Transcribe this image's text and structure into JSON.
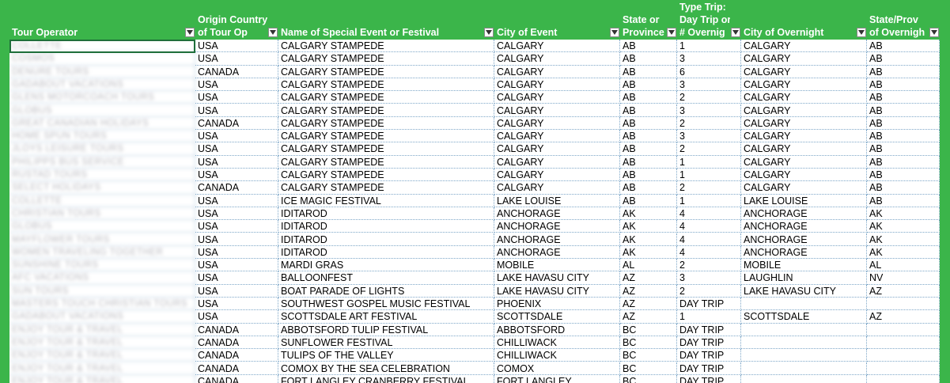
{
  "headers": [
    {
      "name": "tour-operator",
      "lines": [
        "Tour Operator"
      ]
    },
    {
      "name": "origin-country",
      "lines": [
        "Origin Country",
        "of Tour Op"
      ]
    },
    {
      "name": "event-name",
      "lines": [
        "Name of Special Event or Festival"
      ]
    },
    {
      "name": "city-of-event",
      "lines": [
        "City of Event"
      ]
    },
    {
      "name": "state-or-province",
      "lines": [
        "State or",
        "Province"
      ]
    },
    {
      "name": "type-trip",
      "lines": [
        "Type Trip:",
        "Day Trip or",
        "# Overnig"
      ]
    },
    {
      "name": "city-of-overnight",
      "lines": [
        "City of Overnight"
      ]
    },
    {
      "name": "state-prov-overnight",
      "lines": [
        "State/Prov",
        "of Overnigh"
      ]
    }
  ],
  "rows": [
    [
      "COLLETTE",
      "USA",
      "CALGARY STAMPEDE",
      "CALGARY",
      "AB",
      "1",
      "CALGARY",
      "AB"
    ],
    [
      "COSMOS",
      "USA",
      "CALGARY STAMPEDE",
      "CALGARY",
      "AB",
      "3",
      "CALGARY",
      "AB"
    ],
    [
      "DENURE TOURS",
      "CANADA",
      "CALGARY STAMPEDE",
      "CALGARY",
      "AB",
      "6",
      "CALGARY",
      "AB"
    ],
    [
      "GADABOUT VACATIONS",
      "USA",
      "CALGARY STAMPEDE",
      "CALGARY",
      "AB",
      "3",
      "CALGARY",
      "AB"
    ],
    [
      "GLENS MOTORCOACH TOURS",
      "USA",
      "CALGARY STAMPEDE",
      "CALGARY",
      "AB",
      "2",
      "CALGARY",
      "AB"
    ],
    [
      "GLOBUS",
      "USA",
      "CALGARY STAMPEDE",
      "CALGARY",
      "AB",
      "3",
      "CALGARY",
      "AB"
    ],
    [
      "GREAT CANADIAN HOLIDAYS",
      "CANADA",
      "CALGARY STAMPEDE",
      "CALGARY",
      "AB",
      "2",
      "CALGARY",
      "AB"
    ],
    [
      "HOME SPUN TOURS",
      "USA",
      "CALGARY STAMPEDE",
      "CALGARY",
      "AB",
      "3",
      "CALGARY",
      "AB"
    ],
    [
      "JLOYS LEISURE TOURS",
      "USA",
      "CALGARY STAMPEDE",
      "CALGARY",
      "AB",
      "2",
      "CALGARY",
      "AB"
    ],
    [
      "PHILIPPS BUS SERVICE",
      "USA",
      "CALGARY STAMPEDE",
      "CALGARY",
      "AB",
      "1",
      "CALGARY",
      "AB"
    ],
    [
      "RUSTAD TOURS",
      "USA",
      "CALGARY STAMPEDE",
      "CALGARY",
      "AB",
      "1",
      "CALGARY",
      "AB"
    ],
    [
      "SELECT HOLIDAYS",
      "CANADA",
      "CALGARY STAMPEDE",
      "CALGARY",
      "AB",
      "2",
      "CALGARY",
      "AB"
    ],
    [
      "COLLETTE",
      "USA",
      "ICE MAGIC FESTIVAL",
      "LAKE LOUISE",
      "AB",
      "1",
      "LAKE LOUISE",
      "AB"
    ],
    [
      "CHRISTIAN TOURS",
      "USA",
      "IDITAROD",
      "ANCHORAGE",
      "AK",
      "4",
      "ANCHORAGE",
      "AK"
    ],
    [
      "GLOBUS",
      "USA",
      "IDITAROD",
      "ANCHORAGE",
      "AK",
      "4",
      "ANCHORAGE",
      "AK"
    ],
    [
      "MAYFLOWER TOURS",
      "USA",
      "IDITAROD",
      "ANCHORAGE",
      "AK",
      "4",
      "ANCHORAGE",
      "AK"
    ],
    [
      "WOMEN TRAVELING TOGETHER",
      "USA",
      "IDITAROD",
      "ANCHORAGE",
      "AK",
      "4",
      "ANCHORAGE",
      "AK"
    ],
    [
      "SUNSHINE TOURS",
      "USA",
      "MARDI GRAS",
      "MOBILE",
      "AL",
      "2",
      "MOBILE",
      "AL"
    ],
    [
      "AFC VACATIONS",
      "USA",
      "BALLOONFEST",
      "LAKE HAVASU CITY",
      "AZ",
      "3",
      "LAUGHLIN",
      "NV"
    ],
    [
      "SUN TOURS",
      "USA",
      "BOAT PARADE OF LIGHTS",
      "LAKE HAVASU CITY",
      "AZ",
      "2",
      "LAKE HAVASU CITY",
      "AZ"
    ],
    [
      "MASTERS TOUCH CHRISTIAN TOURS",
      "USA",
      "SOUTHWEST GOSPEL MUSIC FESTIVAL",
      "PHOENIX",
      "AZ",
      "DAY TRIP",
      "",
      ""
    ],
    [
      "GADABOUT VACATIONS",
      "USA",
      "SCOTTSDALE ART FESTIVAL",
      "SCOTTSDALE",
      "AZ",
      "1",
      "SCOTTSDALE",
      "AZ"
    ],
    [
      "ENJOY TOUR & TRAVEL",
      "CANADA",
      "ABBOTSFORD TULIP FESTIVAL",
      "ABBOTSFORD",
      "BC",
      "DAY TRIP",
      "",
      ""
    ],
    [
      "ENJOY TOUR & TRAVEL",
      "CANADA",
      "SUNFLOWER FESTIVAL",
      "CHILLIWACK",
      "BC",
      "DAY TRIP",
      "",
      ""
    ],
    [
      "ENJOY TOUR & TRAVEL",
      "CANADA",
      "TULIPS OF THE VALLEY",
      "CHILLIWACK",
      "BC",
      "DAY TRIP",
      "",
      ""
    ],
    [
      "ENJOY TOUR & TRAVEL",
      "CANADA",
      "COMOX BY THE SEA CELEBRATION",
      "COMOX",
      "BC",
      "DAY TRIP",
      "",
      ""
    ],
    [
      "ENJOY TOUR & TRAVEL",
      "CANADA",
      "FORT LANGLEY CRANBERRY FESTIVAL",
      "FORT LANGLEY",
      "BC",
      "DAY TRIP",
      "",
      ""
    ]
  ]
}
